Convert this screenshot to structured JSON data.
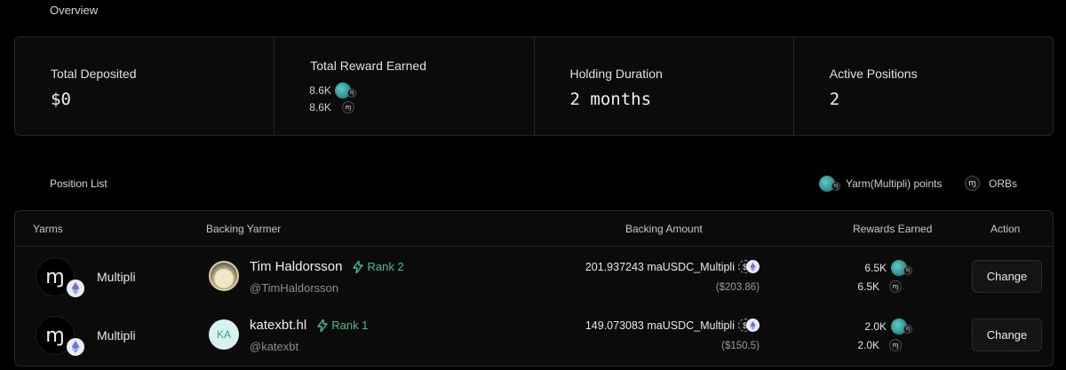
{
  "overview": {
    "title": "Overview",
    "total_deposited": {
      "label": "Total Deposited",
      "value": "$0"
    },
    "total_reward": {
      "label": "Total Reward Earned",
      "rows": [
        "8.6K",
        "8.6K"
      ]
    },
    "holding_duration": {
      "label": "Holding Duration",
      "value": "2 months"
    },
    "active_positions": {
      "label": "Active Positions",
      "value": "2"
    }
  },
  "positions": {
    "title": "Position List",
    "legend": {
      "points_label": "Yarm(Multipli) points",
      "orbs_label": "ORBs"
    },
    "columns": [
      "Yarms",
      "Backing Yarmer",
      "Backing Amount",
      "Rewards Earned",
      "Action"
    ],
    "rows": [
      {
        "yarm": "Multipli",
        "yarmer": "Tim Haldorsson",
        "rank": "Rank 2",
        "handle": "@TimHaldorsson",
        "amount": "201.937243 maUSDC_Multipli",
        "usd": "($203.86)",
        "reward_points": "6.5K",
        "reward_orbs": "6.5K",
        "action": "Change"
      },
      {
        "yarm": "Multipli",
        "yarmer": "katexbt.hl",
        "avatar_initials": "KA",
        "rank": "Rank 1",
        "handle": "@katexbt",
        "amount": "149.073083 maUSDC_Multipli",
        "usd": "($150.5)",
        "reward_points": "2.0K",
        "reward_orbs": "2.0K",
        "action": "Change"
      }
    ]
  },
  "colors": {
    "background": "#000000",
    "card": "#0b0b0c",
    "border": "#26272a",
    "rank_green": "#40c08a",
    "token_teal": "#2a8a87"
  },
  "icons": {
    "points_token": "yarm-points-token-icon",
    "orb_token": "orb-token-icon",
    "rank": "lightning-bolt-icon",
    "chain": "ethereum-icon"
  }
}
